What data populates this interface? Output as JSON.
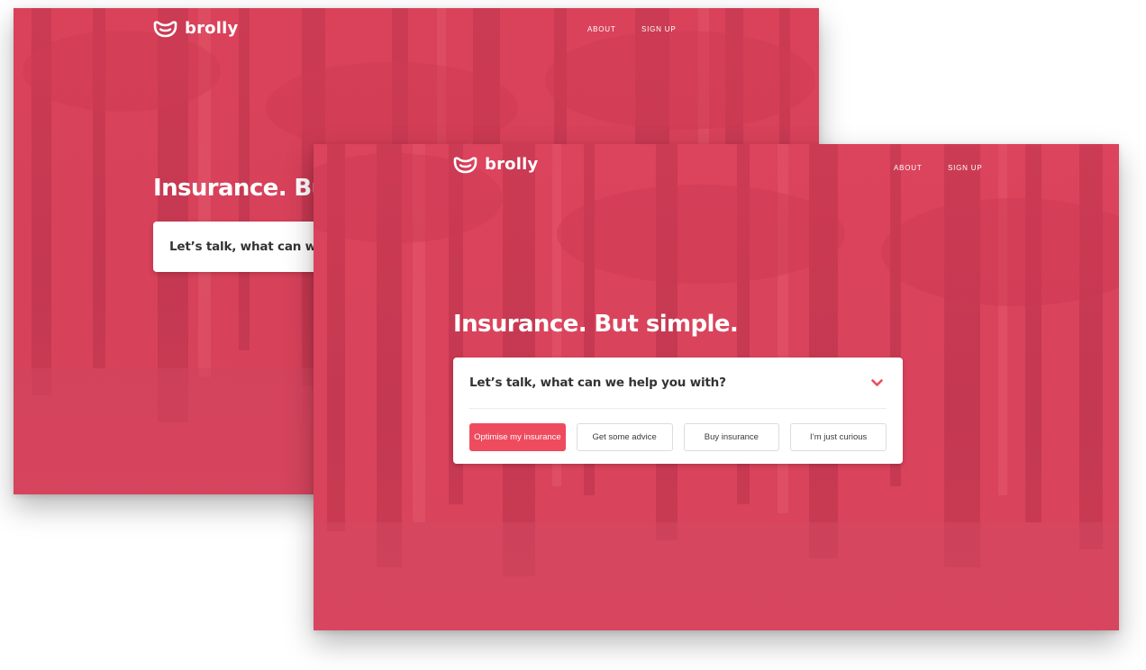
{
  "brand": {
    "name": "brolly",
    "logo_icon": "umbrella-smile-icon"
  },
  "nav": {
    "about": "ABOUT",
    "sign_up": "SIGN UP"
  },
  "hero": {
    "headline": "Insurance. But simple."
  },
  "assistant": {
    "question": "Let’s talk, what can we help you with?",
    "chevron_icon": "chevron-down-icon",
    "options": [
      {
        "label": "Optimise my insurance",
        "selected": true
      },
      {
        "label": "Get some advice",
        "selected": false
      },
      {
        "label": "Buy insurance",
        "selected": false
      },
      {
        "label": "I’m just curious",
        "selected": false
      }
    ]
  },
  "colors": {
    "brand_red": "#ef4b5e",
    "overlay_red": "#d9425a",
    "text_dark": "#333333"
  }
}
